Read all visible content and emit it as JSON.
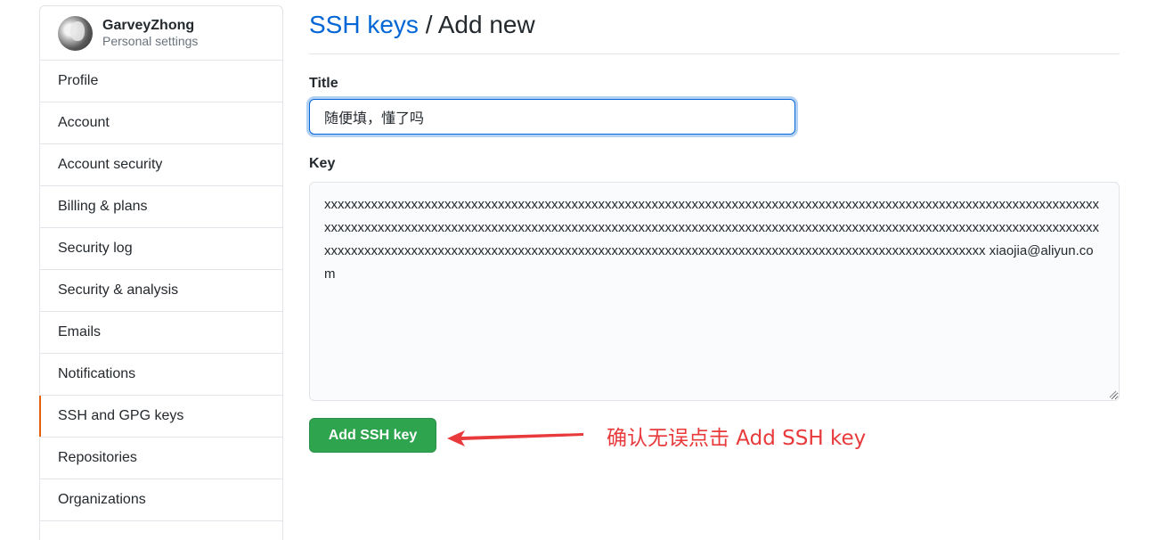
{
  "profile": {
    "name": "GarveyZhong",
    "subtitle": "Personal settings"
  },
  "sidebar": {
    "items": [
      {
        "label": "Profile"
      },
      {
        "label": "Account"
      },
      {
        "label": "Account security"
      },
      {
        "label": "Billing & plans"
      },
      {
        "label": "Security log"
      },
      {
        "label": "Security & analysis"
      },
      {
        "label": "Emails"
      },
      {
        "label": "Notifications"
      },
      {
        "label": "SSH and GPG keys",
        "selected": true
      },
      {
        "label": "Repositories"
      },
      {
        "label": "Organizations"
      }
    ]
  },
  "header": {
    "breadcrumb_link": "SSH keys",
    "separator": " / ",
    "current": "Add new"
  },
  "form": {
    "title_label": "Title",
    "title_value": "随便填，懂了吗",
    "key_label": "Key",
    "key_value": "xxxxxxxxxxxxxxxxxxxxxxxxxxxxxxxxxxxxxxxxxxxxxxxxxxxxxxxxxxxxxxxxxxxxxxxxxxxxxxxxxxxxxxxxxxxxxxxxxxxxxxxxxxxxxxxxxxxxxxxxxxxxxxxxxxxxxxxxxxxxxxxxxxxxxxxxxxxxxxxxxxxxxxxxxxxxxxxxxxxxxxxxxxxxxxxxxxxxxxxxxxxxxxxxxxxxxxxxxxxxxxxxxxxxxxxxxxxxxxxxxxxxxxxxxxxxxxxxxxxxxxxxxxxxxxxxxxxxxxxxxxxxxxxxxxxxxxxxxxxxxxxxxxxxxxxxxxxxxxxxxxxxxxxxxxx xiaojia@aliyun.com",
    "submit_label": "Add SSH key"
  },
  "annotation": {
    "text": "确认无误点击 Add SSH key",
    "color": "#e8393b"
  },
  "colors": {
    "link": "#0366d6",
    "primary_button": "#2ea44f",
    "selected_indicator": "#e36209"
  }
}
